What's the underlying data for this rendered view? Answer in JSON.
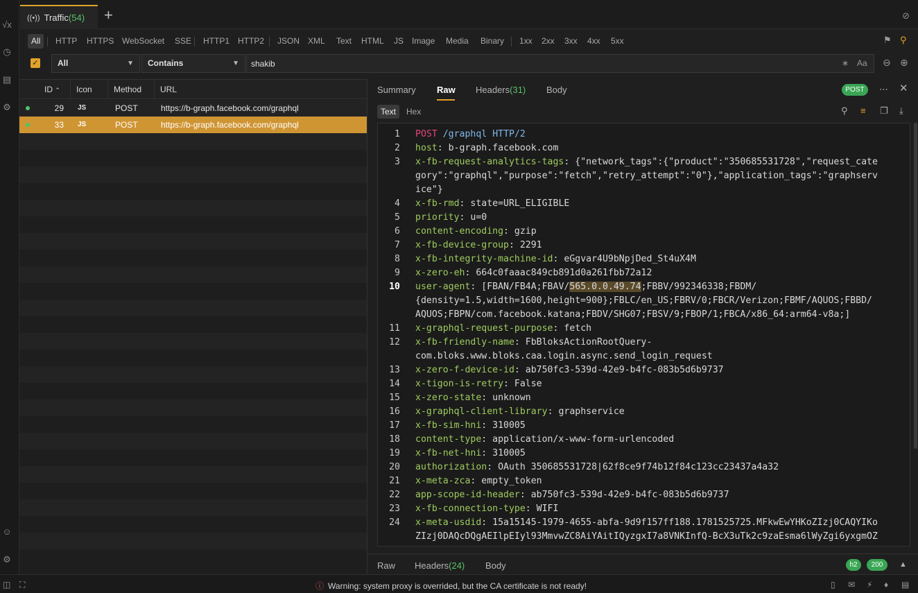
{
  "rail": {
    "icons": [
      "sqrt-icon",
      "history-icon",
      "script-icon",
      "tools-icon",
      "user-icon",
      "settings-icon"
    ]
  },
  "tab": {
    "icon": "antenna-icon",
    "label": "Traffic",
    "count": "(54)"
  },
  "filters": {
    "chips": [
      "All",
      "HTTP",
      "HTTPS",
      "WebSocket",
      "SSE",
      "HTTP1",
      "HTTP2",
      "JSON",
      "XML",
      "Text",
      "HTML",
      "JS",
      "Image",
      "Media",
      "Binary",
      "1xx",
      "2xx",
      "3xx",
      "4xx",
      "5xx"
    ],
    "active": "All"
  },
  "search": {
    "scope": "All",
    "operator": "Contains",
    "query": "shakib",
    "case_label": "Aa"
  },
  "table": {
    "columns": [
      "ID",
      "Icon",
      "Method",
      "URL"
    ],
    "sort_indicator": "^",
    "rows": [
      {
        "id": "29",
        "icon": "JS",
        "method": "POST",
        "url": "https://b-graph.facebook.com/graphql",
        "selected": false
      },
      {
        "id": "33",
        "icon": "JS",
        "method": "POST",
        "url": "https://b-graph.facebook.com/graphql",
        "selected": true
      }
    ]
  },
  "detail": {
    "tabs": {
      "summary": "Summary",
      "raw": "Raw",
      "headers": "Headers",
      "headers_count": "(31)",
      "body": "Body"
    },
    "method_badge": "POST",
    "subtabs": {
      "text": "Text",
      "hex": "Hex"
    },
    "lines": [
      {
        "n": "1",
        "segs": [
          [
            "m",
            "POST"
          ],
          [
            "v",
            " "
          ],
          [
            "p",
            "/graphql"
          ],
          [
            "v",
            " "
          ],
          [
            "p",
            "HTTP/2"
          ]
        ]
      },
      {
        "n": "2",
        "segs": [
          [
            "k",
            "host"
          ],
          [
            "v",
            ": b-graph.facebook.com"
          ]
        ]
      },
      {
        "n": "3",
        "segs": [
          [
            "k",
            "x-fb-request-analytics-tags"
          ],
          [
            "v",
            ": {\"network_tags\":{\"product\":\"350685531728\",\"request_cate"
          ]
        ]
      },
      {
        "n": "",
        "segs": [
          [
            "v",
            "gory\":\"graphql\",\"purpose\":\"fetch\",\"retry_attempt\":\"0\"},\"application_tags\":\"graphserv"
          ]
        ]
      },
      {
        "n": "",
        "segs": [
          [
            "v",
            "ice\"}"
          ]
        ]
      },
      {
        "n": "4",
        "segs": [
          [
            "k",
            "x-fb-rmd"
          ],
          [
            "v",
            ": state=URL_ELIGIBLE"
          ]
        ]
      },
      {
        "n": "5",
        "segs": [
          [
            "k",
            "priority"
          ],
          [
            "v",
            ": u=0"
          ]
        ]
      },
      {
        "n": "6",
        "segs": [
          [
            "k",
            "content-encoding"
          ],
          [
            "v",
            ": gzip"
          ]
        ]
      },
      {
        "n": "7",
        "segs": [
          [
            "k",
            "x-fb-device-group"
          ],
          [
            "v",
            ": 2291"
          ]
        ]
      },
      {
        "n": "8",
        "segs": [
          [
            "k",
            "x-fb-integrity-machine-id"
          ],
          [
            "v",
            ": eGgvar4U9bNpjDed_St4uX4M"
          ]
        ]
      },
      {
        "n": "9",
        "segs": [
          [
            "k",
            "x-zero-eh"
          ],
          [
            "v",
            ": 664c0faaac849cb891d0a261fbb72a12"
          ]
        ]
      },
      {
        "n": "10",
        "cur": true,
        "segs": [
          [
            "k",
            "user-agent"
          ],
          [
            "v",
            ": [FBAN/FB4A;FBAV/"
          ],
          [
            "h",
            "565.0.0.49.74"
          ],
          [
            "v",
            ";FBBV/992346338;FBDM/"
          ]
        ]
      },
      {
        "n": "",
        "segs": [
          [
            "v",
            "{density=1.5,width=1600,height=900};FBLC/en_US;FBRV/0;FBCR/Verizon;FBMF/AQUOS;FBBD/"
          ]
        ]
      },
      {
        "n": "",
        "segs": [
          [
            "v",
            "AQUOS;FBPN/com.facebook.katana;FBDV/SHG07;FBSV/9;FBOP/1;FBCA/x86_64:arm64-v8a;]"
          ]
        ]
      },
      {
        "n": "11",
        "segs": [
          [
            "k",
            "x-graphql-request-purpose"
          ],
          [
            "v",
            ": fetch"
          ]
        ]
      },
      {
        "n": "12",
        "segs": [
          [
            "k",
            "x-fb-friendly-name"
          ],
          [
            "v",
            ": FbBloksActionRootQuery-"
          ]
        ]
      },
      {
        "n": "",
        "segs": [
          [
            "v",
            "com.bloks.www.bloks.caa.login.async.send_login_request"
          ]
        ]
      },
      {
        "n": "13",
        "segs": [
          [
            "k",
            "x-zero-f-device-id"
          ],
          [
            "v",
            ": ab750fc3-539d-42e9-b4fc-083b5d6b9737"
          ]
        ]
      },
      {
        "n": "14",
        "segs": [
          [
            "k",
            "x-tigon-is-retry"
          ],
          [
            "v",
            ": False"
          ]
        ]
      },
      {
        "n": "15",
        "segs": [
          [
            "k",
            "x-zero-state"
          ],
          [
            "v",
            ": unknown"
          ]
        ]
      },
      {
        "n": "16",
        "segs": [
          [
            "k",
            "x-graphql-client-library"
          ],
          [
            "v",
            ": graphservice"
          ]
        ]
      },
      {
        "n": "17",
        "segs": [
          [
            "k",
            "x-fb-sim-hni"
          ],
          [
            "v",
            ": 310005"
          ]
        ]
      },
      {
        "n": "18",
        "segs": [
          [
            "k",
            "content-type"
          ],
          [
            "v",
            ": application/x-www-form-urlencoded"
          ]
        ]
      },
      {
        "n": "19",
        "segs": [
          [
            "k",
            "x-fb-net-hni"
          ],
          [
            "v",
            ": 310005"
          ]
        ]
      },
      {
        "n": "20",
        "segs": [
          [
            "k",
            "authorization"
          ],
          [
            "v",
            ": OAuth 350685531728|62f8ce9f74b12f84c123cc23437a4a32"
          ]
        ]
      },
      {
        "n": "21",
        "segs": [
          [
            "k",
            "x-meta-zca"
          ],
          [
            "v",
            ": empty_token"
          ]
        ]
      },
      {
        "n": "22",
        "segs": [
          [
            "k",
            "app-scope-id-header"
          ],
          [
            "v",
            ": ab750fc3-539d-42e9-b4fc-083b5d6b9737"
          ]
        ]
      },
      {
        "n": "23",
        "segs": [
          [
            "k",
            "x-fb-connection-type"
          ],
          [
            "v",
            ": WIFI"
          ]
        ]
      },
      {
        "n": "24",
        "segs": [
          [
            "k",
            "x-meta-usdid"
          ],
          [
            "v",
            ": 15a15145-1979-4655-abfa-9d9f157ff188.1781525725.MFkwEwYHKoZIzj0CAQYIKo"
          ]
        ]
      },
      {
        "n": "",
        "segs": [
          [
            "v",
            "ZIzj0DAQcDQgAEIlpEIyl93MmvwZC8AiYAitIQyzgxI7a8VNKInfQ-BcX3uTk2c9zaEsma6lWyZgi6yxgmOZ"
          ]
        ]
      }
    ]
  },
  "response": {
    "raw": "Raw",
    "headers": "Headers",
    "headers_count": "(24)",
    "body": "Body",
    "protocol_badge": "h2",
    "status_badge": "200"
  },
  "status": {
    "warning": "Warning: system proxy is overrided, but the CA certificate is not ready!"
  },
  "colors": {
    "accent": "#e2a32b",
    "selected_row": "#cf9533",
    "badge_green": "#3aa655",
    "key": "#9fcc5f",
    "method": "#e0457b",
    "path": "#7fb7e8"
  }
}
